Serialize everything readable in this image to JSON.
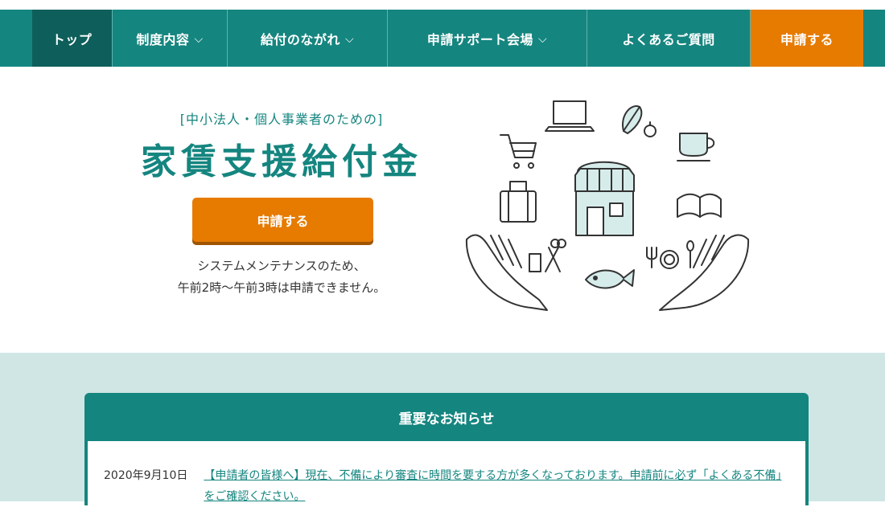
{
  "nav": {
    "items": [
      {
        "label": "トップ",
        "chevron": ""
      },
      {
        "label": "制度内容",
        "chevron": "⌵"
      },
      {
        "label": "給付のながれ",
        "chevron": "⌵"
      },
      {
        "label": "申請サポート会場",
        "chevron": "⌵"
      },
      {
        "label": "よくあるご質問",
        "chevron": ""
      },
      {
        "label": "申請する",
        "chevron": ""
      }
    ]
  },
  "hero": {
    "subtitle": "[中小法人・個人事業者のための]",
    "title": "家賃支援給付金",
    "apply_button": "申請する",
    "note_line1": "システムメンテナンスのため、",
    "note_line2": "午前2時～午前3時は申請できません。"
  },
  "notice": {
    "heading": "重要なお知らせ",
    "items": [
      {
        "date": "2020年9月10日",
        "text": "【申請者の皆様へ】現在、不備により審査に時間を要する方が多くなっております。申請前に必ず「よくある不備」をご確認ください。"
      }
    ]
  },
  "colors": {
    "brand": "#15857f",
    "accent": "#e67b00",
    "section_bg": "#cfe6e5"
  }
}
